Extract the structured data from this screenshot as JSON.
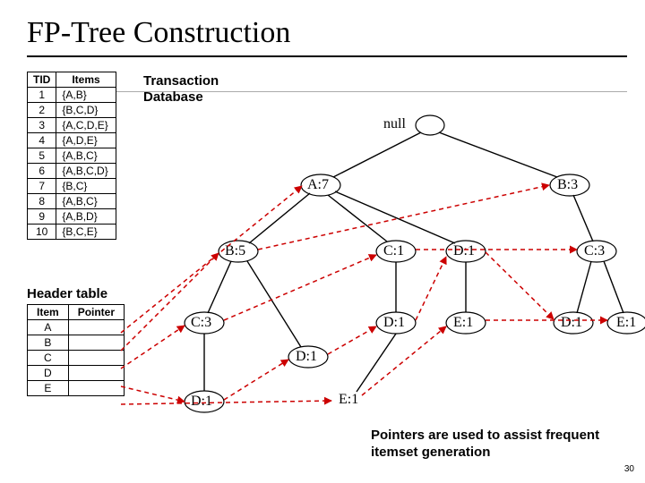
{
  "title": "FP-Tree Construction",
  "labels": {
    "transaction_db": "Transaction\nDatabase",
    "header_table": "Header table",
    "caption": "Pointers are used to assist frequent itemset generation",
    "page": "30"
  },
  "db_table": {
    "headers": [
      "TID",
      "Items"
    ],
    "rows": [
      [
        "1",
        "{A,B}"
      ],
      [
        "2",
        "{B,C,D}"
      ],
      [
        "3",
        "{A,C,D,E}"
      ],
      [
        "4",
        "{A,D,E}"
      ],
      [
        "5",
        "{A,B,C}"
      ],
      [
        "6",
        "{A,B,C,D}"
      ],
      [
        "7",
        "{B,C}"
      ],
      [
        "8",
        "{A,B,C}"
      ],
      [
        "9",
        "{A,B,D}"
      ],
      [
        "10",
        "{B,C,E}"
      ]
    ]
  },
  "header_table": {
    "headers": [
      "Item",
      "Pointer"
    ],
    "rows": [
      [
        "A",
        ""
      ],
      [
        "B",
        ""
      ],
      [
        "C",
        ""
      ],
      [
        "D",
        ""
      ],
      [
        "E",
        ""
      ]
    ]
  },
  "tree": {
    "null": "null",
    "A7": "A:7",
    "B3": "B:3",
    "B5": "B:5",
    "C1": "C:1",
    "D1a": "D:1",
    "C3a": "C:3",
    "C3b": "C:3",
    "D1b": "D:1",
    "D1c": "D:1",
    "D1d": "D:1",
    "D1e": "D:1",
    "E1a": "E:1",
    "E1b": "E:1",
    "E1c": "E:1"
  }
}
